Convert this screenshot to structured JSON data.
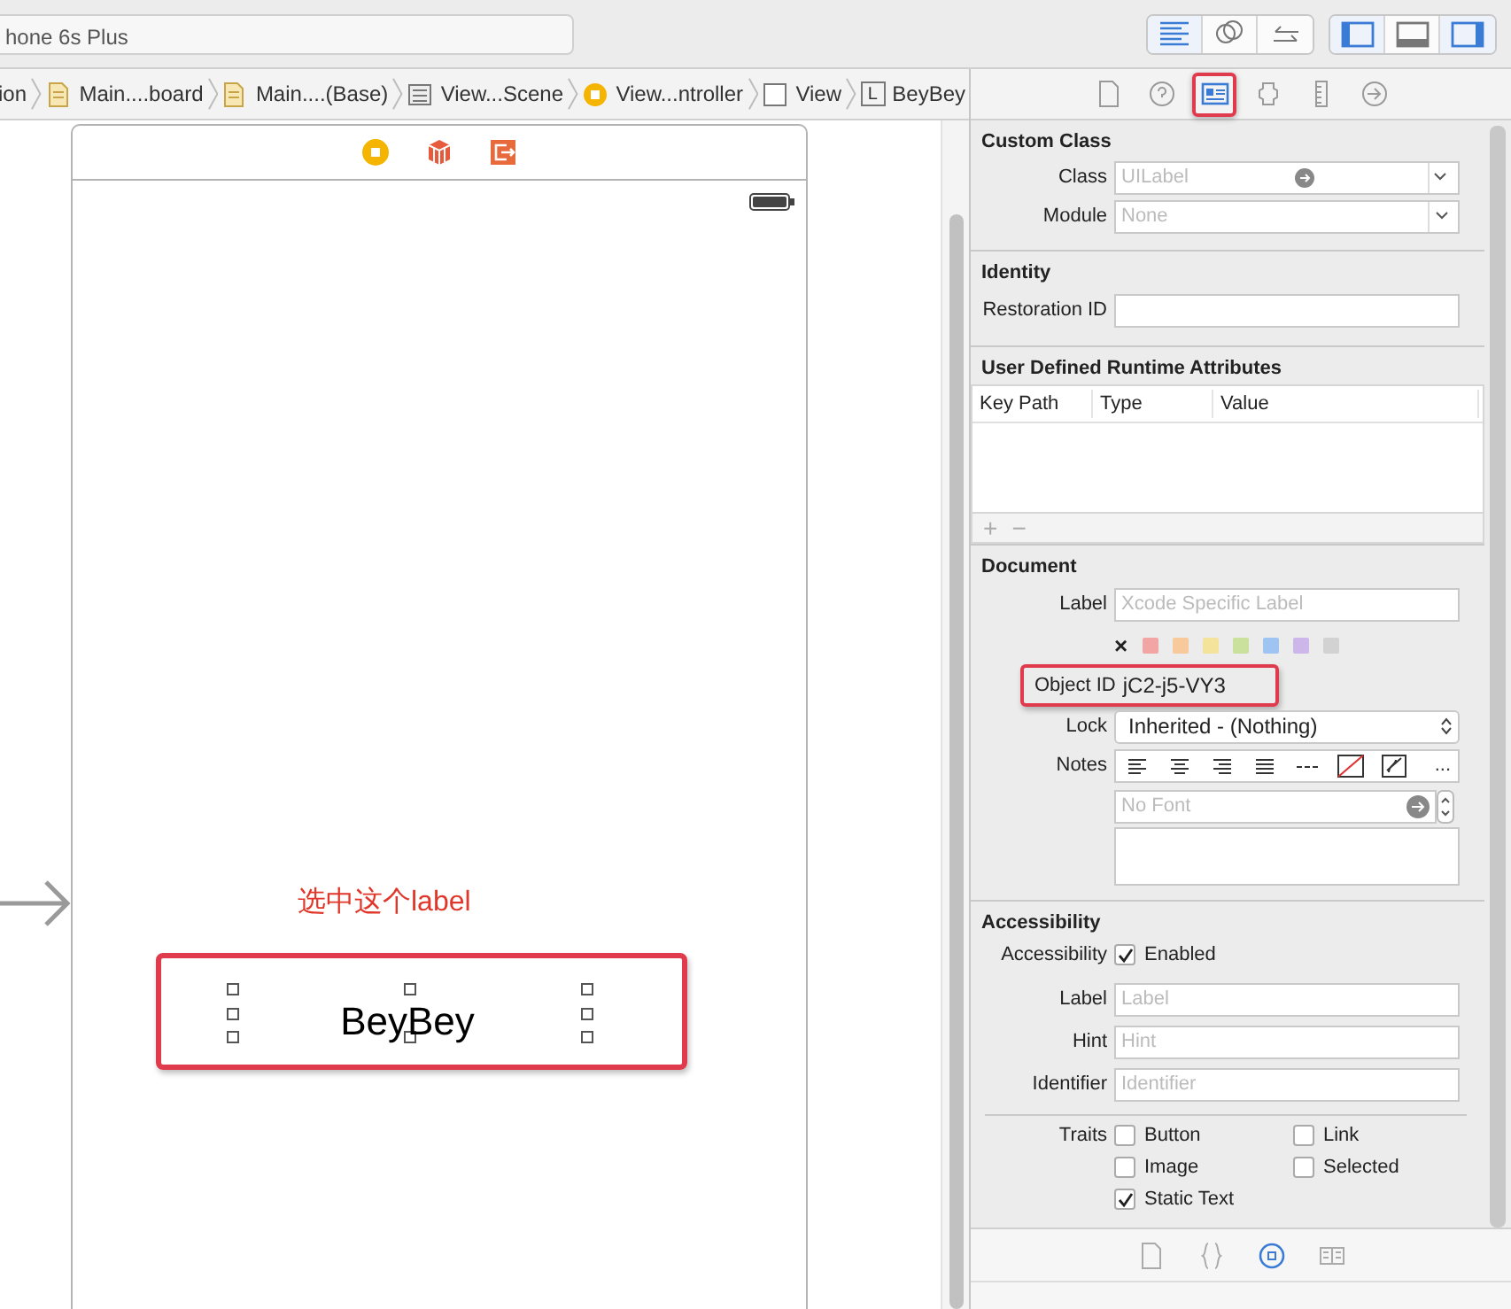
{
  "toolbar": {
    "scheme": "hone 6s Plus",
    "editor_buttons": [
      {
        "kind": "standard",
        "selected": true
      },
      {
        "kind": "assistant",
        "selected": false
      },
      {
        "kind": "version",
        "selected": false
      }
    ],
    "panel_buttons": [
      {
        "kind": "left",
        "on": true
      },
      {
        "kind": "bottom",
        "on": false
      },
      {
        "kind": "right",
        "on": true
      }
    ]
  },
  "breadcrumb": [
    {
      "kind": "text",
      "label": "ion"
    },
    {
      "kind": "storyboard",
      "label": "Main....board"
    },
    {
      "kind": "storyboard",
      "label": "Main....(Base)"
    },
    {
      "kind": "scene",
      "label": "View...Scene"
    },
    {
      "kind": "controller",
      "label": "View...ntroller"
    },
    {
      "kind": "view",
      "label": "View"
    },
    {
      "kind": "label",
      "icon_text": "L",
      "label": "BeyBey"
    }
  ],
  "inspector_tabs": [
    {
      "kind": "file",
      "selected": false,
      "annotated": false
    },
    {
      "kind": "help",
      "selected": false,
      "annotated": false
    },
    {
      "kind": "identity",
      "selected": true,
      "annotated": true
    },
    {
      "kind": "attributes",
      "selected": false,
      "annotated": false
    },
    {
      "kind": "size",
      "selected": false,
      "annotated": false
    },
    {
      "kind": "connections",
      "selected": false,
      "annotated": false
    }
  ],
  "canvas": {
    "annotation": "选中这个label",
    "label_text": "BeyBey",
    "label_annotated": true
  },
  "sections": [
    {
      "title": "Custom Class",
      "rows": [
        {
          "kind": "combo",
          "label": "Class",
          "placeholder": "UILabel",
          "go_arrow": true
        },
        {
          "kind": "combo",
          "label": "Module",
          "placeholder": "None",
          "go_arrow": false
        }
      ]
    },
    {
      "title": "Identity",
      "rows": [
        {
          "kind": "text",
          "label": "Restoration ID"
        }
      ]
    },
    {
      "title": "User Defined Runtime Attributes",
      "rows": [
        {
          "kind": "table",
          "columns": [
            "Key Path",
            "Type",
            "Value"
          ],
          "add": "+",
          "remove": "−"
        }
      ]
    },
    {
      "title": "Document",
      "rows": [
        {
          "kind": "text",
          "label": "Label",
          "placeholder": "Xcode Specific Label"
        },
        {
          "kind": "colors",
          "clear": "×",
          "colors": [
            {
              "color": "#f2a5a5"
            },
            {
              "color": "#f7c99b"
            },
            {
              "color": "#f3e39b"
            },
            {
              "color": "#c9e19d"
            },
            {
              "color": "#9fc4f2"
            },
            {
              "color": "#cdb7ea"
            },
            {
              "color": "#d2d2d2"
            }
          ]
        },
        {
          "kind": "value",
          "label": "Object ID",
          "value": "jC2-j5-VY3",
          "annotated": true
        },
        {
          "kind": "popup",
          "label": "Lock",
          "value": "Inherited - (Nothing)"
        },
        {
          "kind": "notes",
          "label": "Notes",
          "more": "...",
          "font_placeholder": "No Font"
        }
      ]
    },
    {
      "title": "Accessibility",
      "rows": [
        {
          "kind": "checks",
          "label": "Accessibility",
          "options": [
            {
              "label": "Enabled",
              "checked": true
            }
          ]
        },
        {
          "kind": "text",
          "label": "Label",
          "placeholder": "Label"
        },
        {
          "kind": "text",
          "label": "Hint",
          "placeholder": "Hint"
        },
        {
          "kind": "text",
          "label": "Identifier",
          "placeholder": "Identifier"
        },
        {
          "kind": "rule"
        },
        {
          "kind": "checks",
          "label": "Traits",
          "options": [
            {
              "label": "Button",
              "checked": false
            },
            {
              "label": "Link",
              "checked": false
            },
            {
              "label": "Image",
              "checked": false
            },
            {
              "label": "Selected",
              "checked": false
            },
            {
              "label": "Static Text",
              "checked": true
            }
          ]
        }
      ]
    }
  ],
  "library_tabs": [
    {
      "kind": "file",
      "selected": false
    },
    {
      "kind": "braces",
      "selected": false
    },
    {
      "kind": "object",
      "selected": true
    },
    {
      "kind": "media",
      "selected": false
    }
  ]
}
